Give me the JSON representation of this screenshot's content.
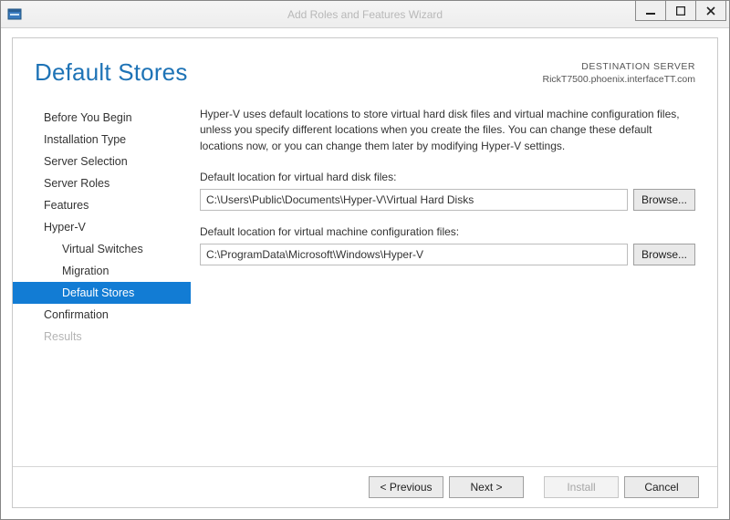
{
  "window": {
    "title": "Add Roles and Features Wizard"
  },
  "header": {
    "page_title": "Default Stores",
    "destination_label": "DESTINATION SERVER",
    "destination_value": "RickT7500.phoenix.interfaceTT.com"
  },
  "sidebar": {
    "items": [
      {
        "label": "Before You Begin",
        "selected": false,
        "sub": false,
        "disabled": false
      },
      {
        "label": "Installation Type",
        "selected": false,
        "sub": false,
        "disabled": false
      },
      {
        "label": "Server Selection",
        "selected": false,
        "sub": false,
        "disabled": false
      },
      {
        "label": "Server Roles",
        "selected": false,
        "sub": false,
        "disabled": false
      },
      {
        "label": "Features",
        "selected": false,
        "sub": false,
        "disabled": false
      },
      {
        "label": "Hyper-V",
        "selected": false,
        "sub": false,
        "disabled": false
      },
      {
        "label": "Virtual Switches",
        "selected": false,
        "sub": true,
        "disabled": false
      },
      {
        "label": "Migration",
        "selected": false,
        "sub": true,
        "disabled": false
      },
      {
        "label": "Default Stores",
        "selected": true,
        "sub": true,
        "disabled": false
      },
      {
        "label": "Confirmation",
        "selected": false,
        "sub": false,
        "disabled": false
      },
      {
        "label": "Results",
        "selected": false,
        "sub": false,
        "disabled": true
      }
    ]
  },
  "main": {
    "description": "Hyper-V uses default locations to store virtual hard disk files and virtual machine configuration files, unless you specify different locations when you create the files. You can change these default locations now, or you can change them later by modifying Hyper-V settings.",
    "vhd_label": "Default location for virtual hard disk files:",
    "vhd_value": "C:\\Users\\Public\\Documents\\Hyper-V\\Virtual Hard Disks",
    "config_label": "Default location for virtual machine configuration files:",
    "config_value": "C:\\ProgramData\\Microsoft\\Windows\\Hyper-V",
    "browse_label": "Browse..."
  },
  "footer": {
    "previous": "< Previous",
    "next": "Next >",
    "install": "Install",
    "cancel": "Cancel"
  }
}
